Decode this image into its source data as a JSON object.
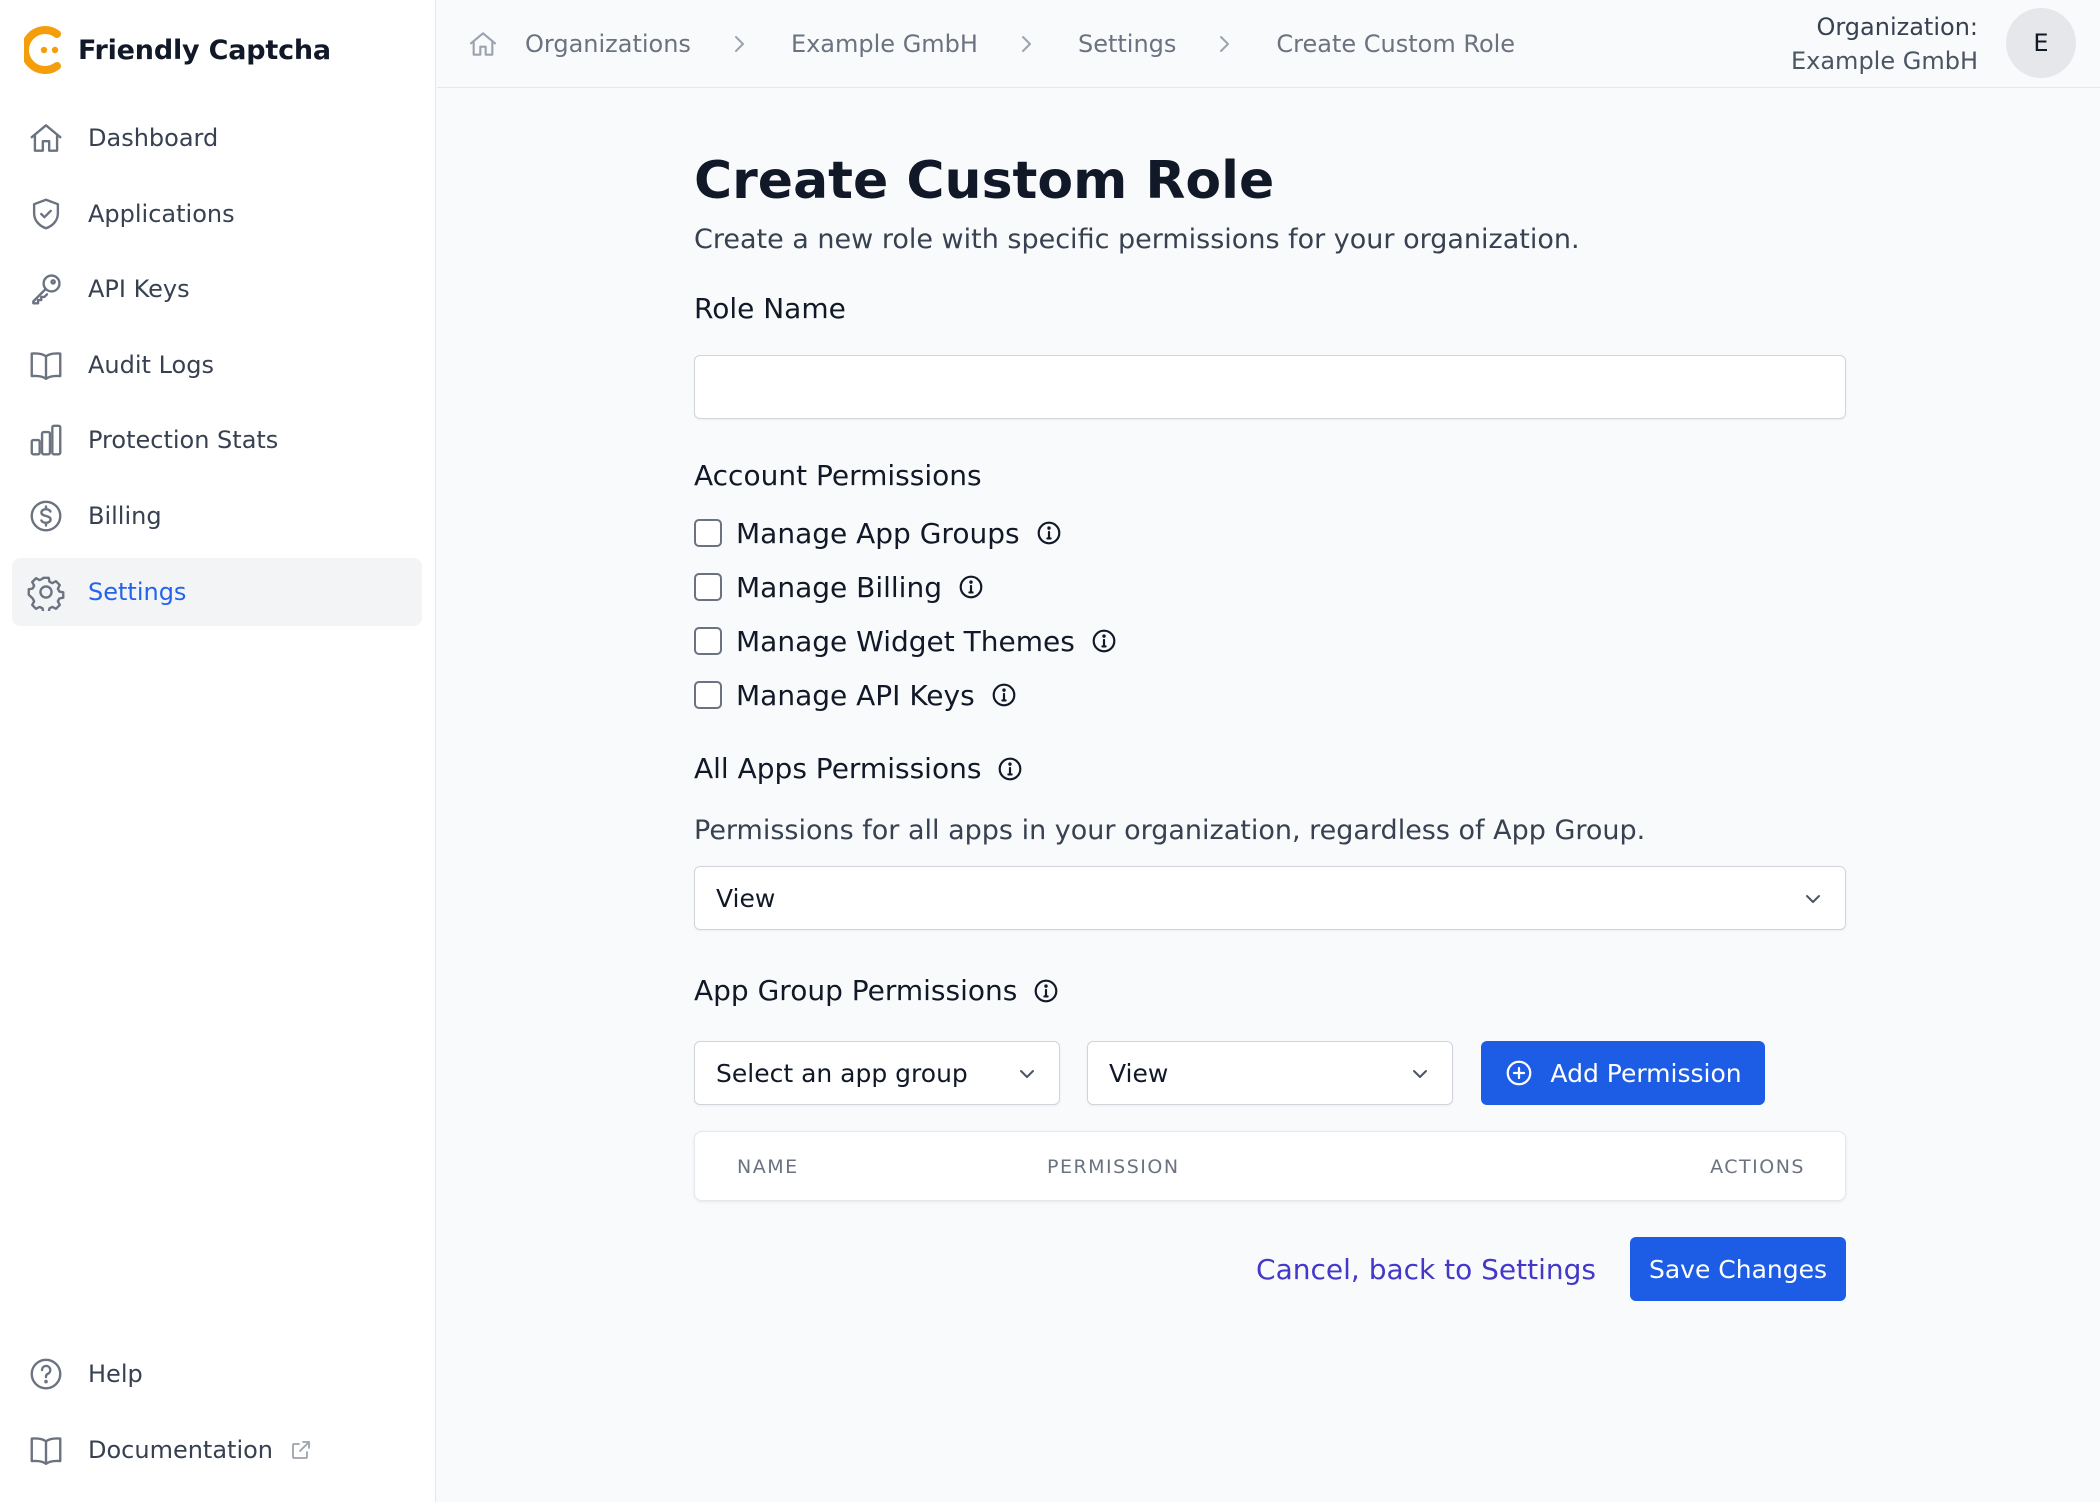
{
  "app": {
    "name": "Friendly Captcha"
  },
  "sidebar": {
    "items": [
      {
        "label": "Dashboard",
        "icon": "home-icon"
      },
      {
        "label": "Applications",
        "icon": "shield-check-icon"
      },
      {
        "label": "API Keys",
        "icon": "key-icon"
      },
      {
        "label": "Audit Logs",
        "icon": "book-open-icon"
      },
      {
        "label": "Protection Stats",
        "icon": "bar-chart-icon"
      },
      {
        "label": "Billing",
        "icon": "dollar-circle-icon"
      },
      {
        "label": "Settings",
        "icon": "gear-icon",
        "active": true
      }
    ],
    "bottom": [
      {
        "label": "Help",
        "icon": "question-circle-icon"
      },
      {
        "label": "Documentation",
        "icon": "book-open-icon",
        "external": true
      }
    ]
  },
  "breadcrumb": [
    "Organizations",
    "Example GmbH",
    "Settings",
    "Create Custom Role"
  ],
  "org": {
    "label": "Organization:",
    "name": "Example GmbH",
    "avatar_initial": "E"
  },
  "page": {
    "title": "Create Custom Role",
    "subtitle": "Create a new role with specific permissions for your organization."
  },
  "role_name": {
    "label": "Role Name",
    "value": ""
  },
  "account_permissions": {
    "label": "Account Permissions",
    "items": [
      {
        "label": "Manage App Groups",
        "checked": false
      },
      {
        "label": "Manage Billing",
        "checked": false
      },
      {
        "label": "Manage Widget Themes",
        "checked": false
      },
      {
        "label": "Manage API Keys",
        "checked": false
      }
    ]
  },
  "all_apps": {
    "label": "All Apps Permissions",
    "description": "Permissions for all apps in your organization, regardless of App Group.",
    "selected": "View"
  },
  "app_group": {
    "label": "App Group Permissions",
    "group_select": "Select an app group",
    "permission_select": "View",
    "add_button": "Add Permission",
    "table_headers": {
      "name": "NAME",
      "permission": "PERMISSION",
      "actions": "ACTIONS"
    }
  },
  "footer": {
    "cancel": "Cancel, back to Settings",
    "save": "Save Changes"
  },
  "colors": {
    "primary": "#1d5de5",
    "active_nav": "#2563eb",
    "link": "#4338ca",
    "logo": "#f59e0b"
  }
}
